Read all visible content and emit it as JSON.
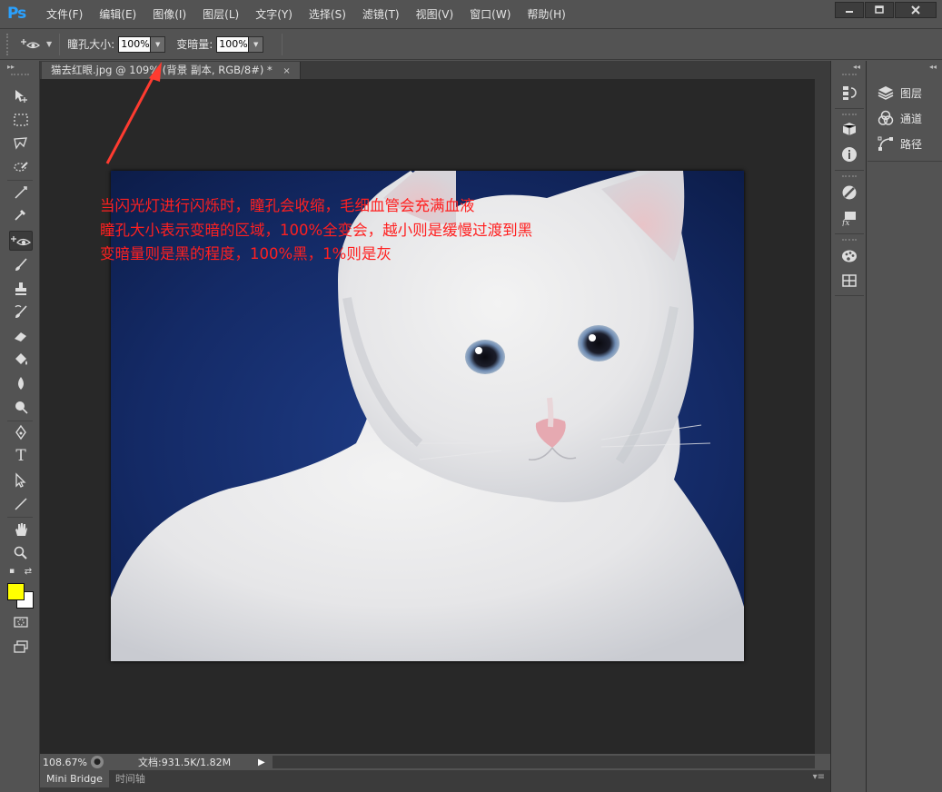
{
  "app": {
    "logo": "Ps",
    "menu": [
      "文件(F)",
      "编辑(E)",
      "图像(I)",
      "图层(L)",
      "文字(Y)",
      "选择(S)",
      "滤镜(T)",
      "视图(V)",
      "窗口(W)",
      "帮助(H)"
    ],
    "window_controls": [
      "minimize-icon",
      "maximize-icon",
      "close-icon"
    ]
  },
  "options": {
    "tool_icon": "red-eye-icon",
    "pupil_size_label": "瞳孔大小:",
    "pupil_size_value": "100%",
    "darken_label": "变暗量:",
    "darken_value": "100%"
  },
  "document": {
    "tab_title": "猫去红眼.jpg @ 109% (背景 副本, RGB/8#) *",
    "image_subject": "white-kitten-on-blue-background"
  },
  "annotation": {
    "lines": [
      "当闪光灯进行闪烁时，瞳孔会收缩，毛细血管会充满血液",
      "瞳孔大小表示变暗的区域，100%全变会，越小则是缓慢过渡到黑",
      "变暗量则是黑的程度，100%黑，1%则是灰"
    ],
    "color": "#ff2020"
  },
  "status": {
    "zoom": "108.67%",
    "doc_info": "文档:931.5K/1.82M"
  },
  "bottom_tabs": [
    "Mini Bridge",
    "时间轴"
  ],
  "tools": [
    "move-icon",
    "marquee-icon",
    "lasso-icon",
    "quick-select-icon",
    "crop-icon",
    "eyedropper-icon",
    "red-eye-icon",
    "brush-icon",
    "stamp-icon",
    "history-brush-icon",
    "eraser-icon",
    "paint-bucket-icon",
    "blur-icon",
    "dodge-icon",
    "pen-icon",
    "type-icon",
    "path-select-icon",
    "line-icon",
    "hand-icon",
    "zoom-icon"
  ],
  "colors": {
    "foreground": "#ffff00",
    "background": "#ffffff",
    "ui_bg": "#535353",
    "canvas_bg": "#282828"
  },
  "panels": [
    {
      "label": "图层",
      "icon": "layers-icon"
    },
    {
      "label": "通道",
      "icon": "channels-icon"
    },
    {
      "label": "路径",
      "icon": "paths-icon"
    }
  ],
  "tab_close": "×"
}
